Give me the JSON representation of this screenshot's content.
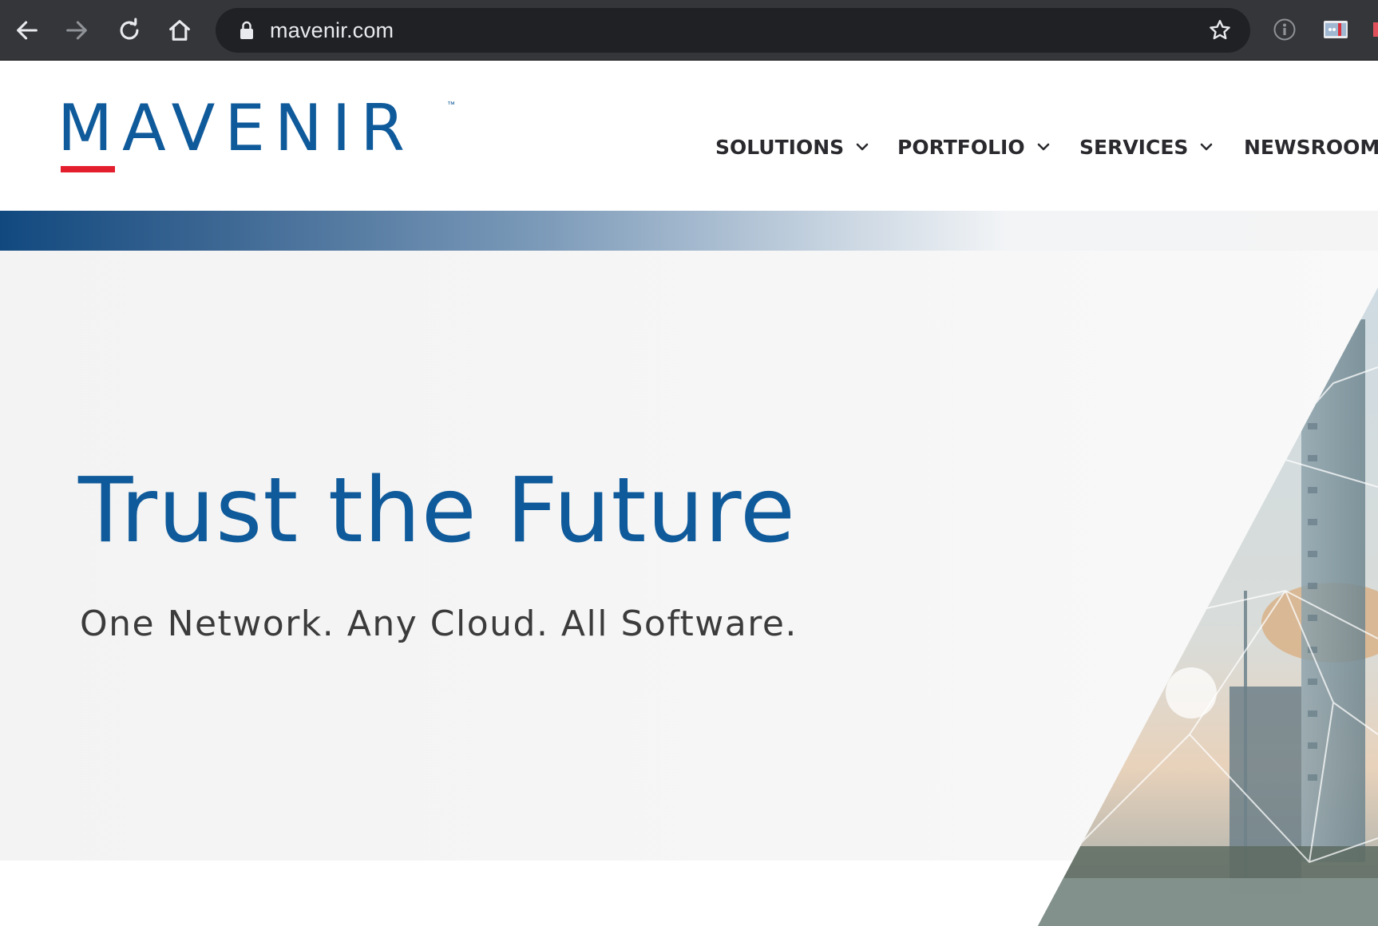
{
  "browser": {
    "url": "mavenir.com",
    "icons": {
      "back": "arrow-left-icon",
      "forward": "arrow-right-icon",
      "reload": "reload-icon",
      "home": "home-icon",
      "lock": "lock-icon",
      "bookmark": "star-icon",
      "extension_info": "info-icon",
      "extension_flag": "flag-icon"
    },
    "colors": {
      "frame": "#35363a",
      "omnibox": "#202124",
      "url_text": "#e8eaed"
    }
  },
  "site": {
    "logo": {
      "text": "MAVENIR",
      "trademark": "™",
      "color": "#0f5a9a",
      "accent": "#e31e2d"
    },
    "nav": {
      "solutions": "SOLUTIONS",
      "portfolio": "PORTFOLIO",
      "services": "SERVICES",
      "newsroom": "NEWSROOM"
    },
    "hero": {
      "title": "Trust the Future",
      "subtitle": "One Network. Any Cloud. All Software.",
      "title_color": "#0f5a9a"
    }
  }
}
